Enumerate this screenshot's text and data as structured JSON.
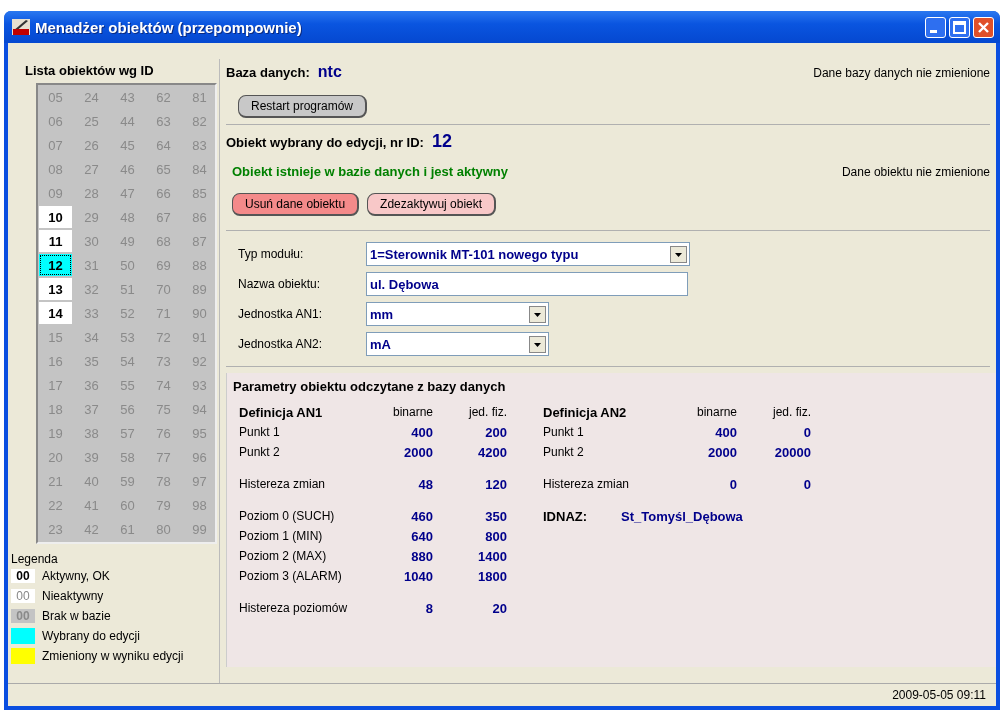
{
  "window": {
    "title": "Menadżer obiektów (przepompownie)"
  },
  "object_list": {
    "title": "Lista obiektów wg ID",
    "columns": [
      [
        {
          "id": "05",
          "kind": "missing",
          "selected": false
        },
        {
          "id": "06",
          "kind": "missing",
          "selected": false
        },
        {
          "id": "07",
          "kind": "missing",
          "selected": false
        },
        {
          "id": "08",
          "kind": "missing",
          "selected": false
        },
        {
          "id": "09",
          "kind": "missing",
          "selected": false
        },
        {
          "id": "10",
          "kind": "active",
          "selected": false
        },
        {
          "id": "11",
          "kind": "active",
          "selected": false
        },
        {
          "id": "12",
          "kind": "active",
          "selected": true
        },
        {
          "id": "13",
          "kind": "active",
          "selected": false
        },
        {
          "id": "14",
          "kind": "active",
          "selected": false
        },
        {
          "id": "15",
          "kind": "missing",
          "selected": false
        },
        {
          "id": "16",
          "kind": "missing",
          "selected": false
        },
        {
          "id": "17",
          "kind": "missing",
          "selected": false
        },
        {
          "id": "18",
          "kind": "missing",
          "selected": false
        },
        {
          "id": "19",
          "kind": "missing",
          "selected": false
        },
        {
          "id": "20",
          "kind": "missing",
          "selected": false
        },
        {
          "id": "21",
          "kind": "missing",
          "selected": false
        },
        {
          "id": "22",
          "kind": "missing",
          "selected": false
        },
        {
          "id": "23",
          "kind": "missing",
          "selected": false
        }
      ],
      [
        {
          "id": "24",
          "kind": "missing",
          "selected": false
        },
        {
          "id": "25",
          "kind": "missing",
          "selected": false
        },
        {
          "id": "26",
          "kind": "missing",
          "selected": false
        },
        {
          "id": "27",
          "kind": "missing",
          "selected": false
        },
        {
          "id": "28",
          "kind": "missing",
          "selected": false
        },
        {
          "id": "29",
          "kind": "missing",
          "selected": false
        },
        {
          "id": "30",
          "kind": "missing",
          "selected": false
        },
        {
          "id": "31",
          "kind": "missing",
          "selected": false
        },
        {
          "id": "32",
          "kind": "missing",
          "selected": false
        },
        {
          "id": "33",
          "kind": "missing",
          "selected": false
        },
        {
          "id": "34",
          "kind": "missing",
          "selected": false
        },
        {
          "id": "35",
          "kind": "missing",
          "selected": false
        },
        {
          "id": "36",
          "kind": "missing",
          "selected": false
        },
        {
          "id": "37",
          "kind": "missing",
          "selected": false
        },
        {
          "id": "38",
          "kind": "missing",
          "selected": false
        },
        {
          "id": "39",
          "kind": "missing",
          "selected": false
        },
        {
          "id": "40",
          "kind": "missing",
          "selected": false
        },
        {
          "id": "41",
          "kind": "missing",
          "selected": false
        },
        {
          "id": "42",
          "kind": "missing",
          "selected": false
        }
      ],
      [
        {
          "id": "43",
          "kind": "missing",
          "selected": false
        },
        {
          "id": "44",
          "kind": "missing",
          "selected": false
        },
        {
          "id": "45",
          "kind": "missing",
          "selected": false
        },
        {
          "id": "46",
          "kind": "missing",
          "selected": false
        },
        {
          "id": "47",
          "kind": "missing",
          "selected": false
        },
        {
          "id": "48",
          "kind": "missing",
          "selected": false
        },
        {
          "id": "49",
          "kind": "missing",
          "selected": false
        },
        {
          "id": "50",
          "kind": "missing",
          "selected": false
        },
        {
          "id": "51",
          "kind": "missing",
          "selected": false
        },
        {
          "id": "52",
          "kind": "missing",
          "selected": false
        },
        {
          "id": "53",
          "kind": "missing",
          "selected": false
        },
        {
          "id": "54",
          "kind": "missing",
          "selected": false
        },
        {
          "id": "55",
          "kind": "missing",
          "selected": false
        },
        {
          "id": "56",
          "kind": "missing",
          "selected": false
        },
        {
          "id": "57",
          "kind": "missing",
          "selected": false
        },
        {
          "id": "58",
          "kind": "missing",
          "selected": false
        },
        {
          "id": "59",
          "kind": "missing",
          "selected": false
        },
        {
          "id": "60",
          "kind": "missing",
          "selected": false
        },
        {
          "id": "61",
          "kind": "missing",
          "selected": false
        }
      ],
      [
        {
          "id": "62",
          "kind": "missing",
          "selected": false
        },
        {
          "id": "63",
          "kind": "missing",
          "selected": false
        },
        {
          "id": "64",
          "kind": "missing",
          "selected": false
        },
        {
          "id": "65",
          "kind": "missing",
          "selected": false
        },
        {
          "id": "66",
          "kind": "missing",
          "selected": false
        },
        {
          "id": "67",
          "kind": "missing",
          "selected": false
        },
        {
          "id": "68",
          "kind": "missing",
          "selected": false
        },
        {
          "id": "69",
          "kind": "missing",
          "selected": false
        },
        {
          "id": "70",
          "kind": "missing",
          "selected": false
        },
        {
          "id": "71",
          "kind": "missing",
          "selected": false
        },
        {
          "id": "72",
          "kind": "missing",
          "selected": false
        },
        {
          "id": "73",
          "kind": "missing",
          "selected": false
        },
        {
          "id": "74",
          "kind": "missing",
          "selected": false
        },
        {
          "id": "75",
          "kind": "missing",
          "selected": false
        },
        {
          "id": "76",
          "kind": "missing",
          "selected": false
        },
        {
          "id": "77",
          "kind": "missing",
          "selected": false
        },
        {
          "id": "78",
          "kind": "missing",
          "selected": false
        },
        {
          "id": "79",
          "kind": "missing",
          "selected": false
        },
        {
          "id": "80",
          "kind": "missing",
          "selected": false
        }
      ],
      [
        {
          "id": "81",
          "kind": "missing",
          "selected": false
        },
        {
          "id": "82",
          "kind": "missing",
          "selected": false
        },
        {
          "id": "83",
          "kind": "missing",
          "selected": false
        },
        {
          "id": "84",
          "kind": "missing",
          "selected": false
        },
        {
          "id": "85",
          "kind": "missing",
          "selected": false
        },
        {
          "id": "86",
          "kind": "missing",
          "selected": false
        },
        {
          "id": "87",
          "kind": "missing",
          "selected": false
        },
        {
          "id": "88",
          "kind": "missing",
          "selected": false
        },
        {
          "id": "89",
          "kind": "missing",
          "selected": false
        },
        {
          "id": "90",
          "kind": "missing",
          "selected": false
        },
        {
          "id": "91",
          "kind": "missing",
          "selected": false
        },
        {
          "id": "92",
          "kind": "missing",
          "selected": false
        },
        {
          "id": "93",
          "kind": "missing",
          "selected": false
        },
        {
          "id": "94",
          "kind": "missing",
          "selected": false
        },
        {
          "id": "95",
          "kind": "missing",
          "selected": false
        },
        {
          "id": "96",
          "kind": "missing",
          "selected": false
        },
        {
          "id": "97",
          "kind": "missing",
          "selected": false
        },
        {
          "id": "98",
          "kind": "missing",
          "selected": false
        },
        {
          "id": "99",
          "kind": "missing",
          "selected": false
        }
      ]
    ]
  },
  "legend": {
    "title": "Legenda",
    "items": [
      {
        "kind": "active",
        "sample": "00",
        "label": "Aktywny, OK"
      },
      {
        "kind": "inactive",
        "sample": "00",
        "label": "Nieaktywny"
      },
      {
        "kind": "missing",
        "sample": "00",
        "label": "Brak w bazie"
      },
      {
        "kind": "swatch",
        "color": "#00ffff",
        "label": "Wybrany do edycji"
      },
      {
        "kind": "swatch",
        "color": "#ffff00",
        "label": "Zmieniony w wyniku edycji"
      }
    ]
  },
  "database": {
    "label": "Baza danych:",
    "name": "ntc",
    "status": "Dane bazy danych nie zmienione",
    "restart_button": "Restart programów"
  },
  "object": {
    "label": "Obiekt wybrany do edycji, nr ID:",
    "id": "12",
    "state": "Obiekt istnieje w bazie danych i jest aktywny",
    "status": "Dane obiektu nie zmienione",
    "buttons": [
      {
        "label": "Usuń dane obiektu",
        "kind": "danger"
      },
      {
        "label": "Zdezaktywuj obiekt",
        "kind": "warn"
      }
    ]
  },
  "form": [
    {
      "kind": "dropdown",
      "label": "Typ modułu:",
      "value": "1=Sterownik MT-101 nowego typu",
      "wide": true
    },
    {
      "kind": "text",
      "label": "Nazwa obiektu:",
      "value": "ul. Dębowa",
      "wide": true
    },
    {
      "kind": "dropdown",
      "label": "Jednostka AN1:",
      "value": "mm",
      "wide": false
    },
    {
      "kind": "dropdown",
      "label": "Jednostka AN2:",
      "value": "mA",
      "wide": false
    }
  ],
  "parameters": {
    "title": "Parametry obiektu odczytane z bazy danych",
    "an1": {
      "title": "Definicja AN1",
      "col_binary": "binarne",
      "col_physical": "jed. fiz.",
      "groups": [
        [
          {
            "label": "Punkt 1",
            "binary": "400",
            "physical": "200"
          },
          {
            "label": "Punkt 2",
            "binary": "2000",
            "physical": "4200"
          }
        ],
        [
          {
            "label": "Histereza zmian",
            "binary": "48",
            "physical": "120"
          }
        ],
        [
          {
            "label": "Poziom 0 (SUCH)",
            "binary": "460",
            "physical": "350"
          },
          {
            "label": "Poziom 1 (MIN)",
            "binary": "640",
            "physical": "800"
          },
          {
            "label": "Poziom 2 (MAX)",
            "binary": "880",
            "physical": "1400"
          },
          {
            "label": "Poziom 3 (ALARM)",
            "binary": "1040",
            "physical": "1800"
          }
        ],
        [
          {
            "label": "Histereza poziomów",
            "binary": "8",
            "physical": "20"
          }
        ]
      ]
    },
    "an2": {
      "title": "Definicja AN2",
      "col_binary": "binarne",
      "col_physical": "jed. fiz.",
      "groups": [
        [
          {
            "label": "Punkt 1",
            "binary": "400",
            "physical": "0"
          },
          {
            "label": "Punkt 2",
            "binary": "2000",
            "physical": "20000"
          }
        ],
        [
          {
            "label": "Histereza zmian",
            "binary": "0",
            "physical": "0"
          }
        ]
      ]
    },
    "idnaz": {
      "label": "IDNAZ:",
      "value": "St_Tomyśl_Dębowa"
    }
  },
  "status_bar": {
    "datetime": "2009-05-05 09:11"
  }
}
